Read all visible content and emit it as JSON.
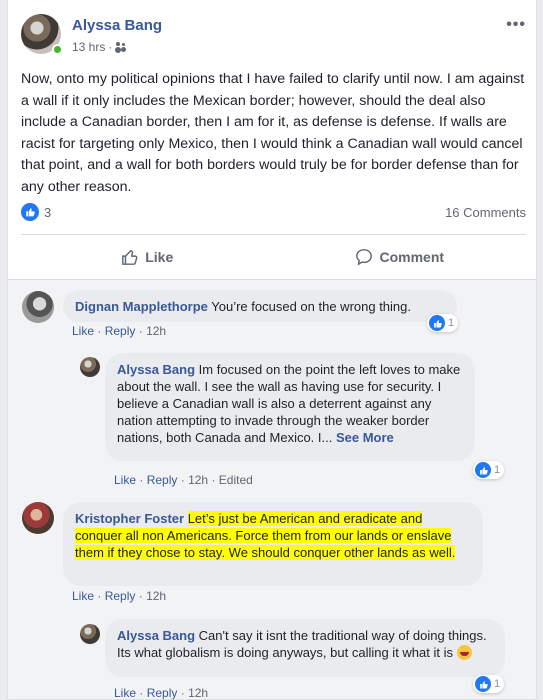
{
  "post": {
    "author": "Alyssa Bang",
    "time": "13 hrs",
    "separator": "·",
    "text": "Now, onto my political opinions that I have failed to clarify until now. I am against a wall if it only includes the Mexican border; however, should the deal also include a Canadian border, then I am for it, as defense is defense. If walls are racist for targeting only Mexico, then I would think a Canadian wall would cancel that point, and a wall for both borders would truly be for border defense than for any other reason.",
    "reaction_count": "3",
    "comments_label": "16 Comments",
    "like_label": "Like",
    "comment_label": "Comment",
    "like_color": "#2078f4",
    "link_color": "#385898"
  },
  "comments": [
    {
      "author": "Dignan Mapplethorpe",
      "text": "You’re focused on the wrong thing.",
      "like": "Like",
      "sep": "·",
      "reply": "Reply",
      "time": "12h",
      "reactions": "1"
    },
    {
      "author": "Alyssa Bang",
      "text": "Im focused on the point the left loves to make about the wall. I see the wall as having use for security. I believe a Canadian wall is also a deterrent against any nation attempting to invade through the weaker border nations, both Canada and Mexico. I...",
      "see_more": "See More",
      "like": "Like",
      "sep": "·",
      "reply": "Reply",
      "time": "12h",
      "edited": "Edited",
      "reactions": "1"
    },
    {
      "author": "Kristopher Foster",
      "text": "Let’s just be American and eradicate and conquer all non Americans. Force them from our lands or enslave them if they chose to stay. We should conquer other lands as well.",
      "highlight_color": "#ffff00",
      "like": "Like",
      "sep": "·",
      "reply": "Reply",
      "time": "12h"
    },
    {
      "author": "Alyssa Bang",
      "text": "Can't say it isnt the traditional way of doing things. Its what globalism is doing anyways, but calling it what it is",
      "emoji": "laughing-face",
      "like": "Like",
      "sep": "·",
      "reply": "Reply",
      "time": "12h",
      "reactions": "1"
    }
  ]
}
